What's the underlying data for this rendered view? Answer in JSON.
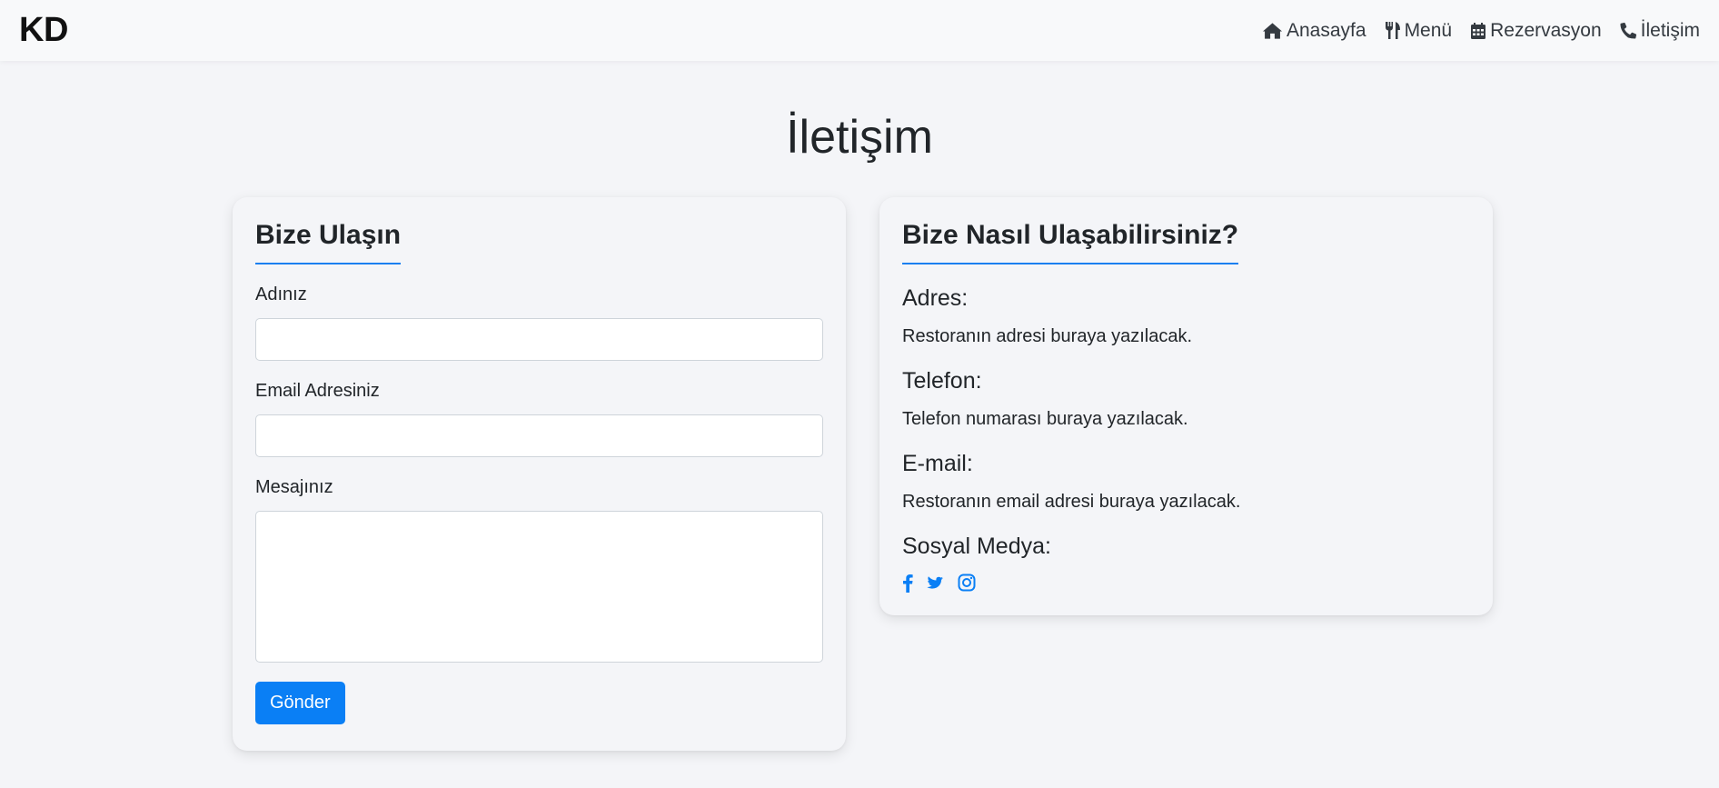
{
  "nav": {
    "brand": "KD",
    "links": [
      {
        "label": "Anasayfa",
        "icon": "home-icon"
      },
      {
        "label": "Menü",
        "icon": "utensils-icon"
      },
      {
        "label": "Rezervasyon",
        "icon": "calendar-icon"
      },
      {
        "label": "İletişim",
        "icon": "phone-icon"
      }
    ]
  },
  "page": {
    "title": "İletişim"
  },
  "contact_form": {
    "title": "Bize Ulaşın",
    "name_label": "Adınız",
    "name_value": "",
    "email_label": "Email Adresiniz",
    "email_value": "",
    "message_label": "Mesajınız",
    "message_value": "",
    "submit_label": "Gönder"
  },
  "contact_info": {
    "title": "Bize Nasıl Ulaşabilirsiniz?",
    "address_heading": "Adres:",
    "address_text": "Restoranın adresi buraya yazılacak.",
    "phone_heading": "Telefon:",
    "phone_text": "Telefon numarası buraya yazılacak.",
    "email_heading": "E-mail:",
    "email_text": "Restoranın email adresi buraya yazılacak.",
    "social_heading": "Sosyal Medya:",
    "social_icons": [
      "facebook-icon",
      "twitter-icon",
      "instagram-icon"
    ]
  },
  "colors": {
    "accent": "#0a7ff5",
    "background": "#f4f5f8",
    "navbar": "#f8f9fa",
    "text": "#212529"
  }
}
